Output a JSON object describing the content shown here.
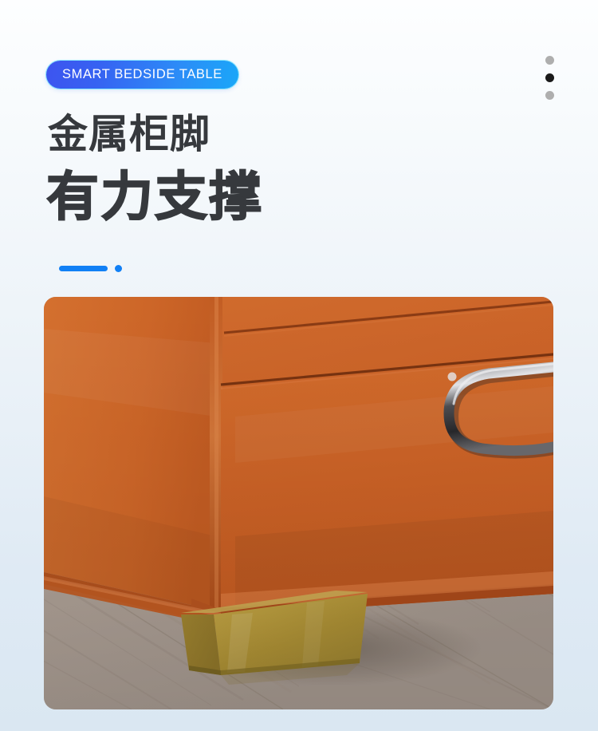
{
  "page": {
    "background_top_color": "#fdfeff",
    "background_bottom_color": "#dae7f2"
  },
  "badge": {
    "label": "SMART BEDSIDE TABLE",
    "gradient_start": "#3d54ef",
    "gradient_end": "#1aa7f8",
    "text_color": "#ffffff"
  },
  "pagination_dots": {
    "items": [
      {
        "state": "inactive",
        "color": "#aeaeae"
      },
      {
        "state": "active",
        "color": "#1a1a1a"
      },
      {
        "state": "inactive",
        "color": "#aeaeae"
      }
    ],
    "active_index": 1
  },
  "headings": {
    "line1": "金属柜脚",
    "line2": "有力支撑",
    "color": "#36393d"
  },
  "divider": {
    "bar_color": "#1180f5",
    "dot_color": "#1180f5"
  },
  "photo": {
    "alt": "Orange leather bedside table corner resting on a brass metal leg over grey wood flooring",
    "cabinet_color": "#cd6327",
    "cabinet_shadow_color": "#a84d1c",
    "metal_leg_color": "#b39338",
    "handle_color": "#3a3a3c",
    "floor_color": "#b3a79c"
  }
}
